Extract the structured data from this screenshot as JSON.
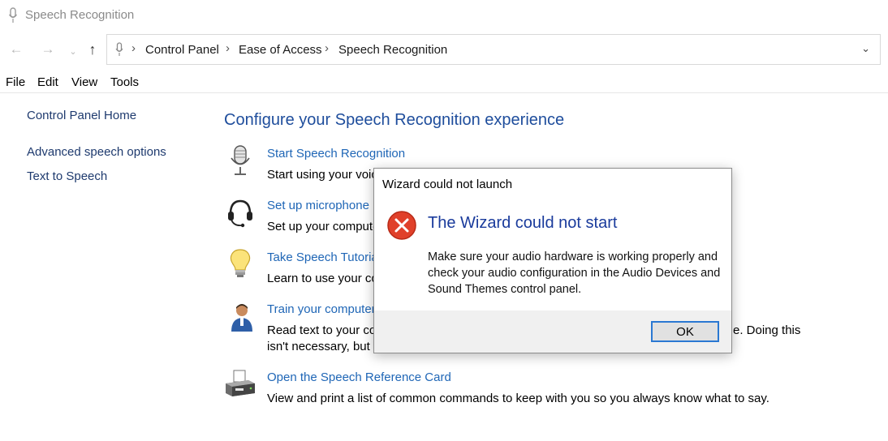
{
  "window": {
    "title": "Speech Recognition"
  },
  "address_bar": {
    "crumbs": [
      "Control Panel",
      "Ease of Access",
      "Speech Recognition"
    ]
  },
  "menu": {
    "items": [
      "File",
      "Edit",
      "View",
      "Tools"
    ]
  },
  "sidebar": {
    "items": [
      "Control Panel Home",
      "Advanced speech options",
      "Text to Speech"
    ]
  },
  "main": {
    "heading": "Configure your Speech Recognition experience",
    "tasks": [
      {
        "link": "Start Speech Recognition",
        "desc": "Start using your voic",
        "icon": "microphone-icon"
      },
      {
        "link": "Set up microphone",
        "desc": "Set up your compute",
        "icon": "headset-icon"
      },
      {
        "link": "Take Speech Tutoria",
        "desc": "Learn to use your co",
        "icon": "lightbulb-icon"
      },
      {
        "link": "Train your computer",
        "desc": "Read text to your co",
        "desc_tail": "e.  Doing this",
        "desc2": "isn't necessary, but c",
        "icon": "user-icon"
      },
      {
        "link": "Open the Speech Reference Card",
        "desc": "View and print a list of common commands to keep with you so you always know what to say.",
        "icon": "printer-icon"
      }
    ]
  },
  "dialog": {
    "title": "Wizard could not launch",
    "heading": "The Wizard could not start",
    "message": "Make sure your audio hardware is working properly and check your audio configuration in the Audio Devices and Sound Themes control panel.",
    "ok_label": "OK",
    "icon": "error-icon"
  },
  "colors": {
    "link": "#1f66b6",
    "heading": "#1e4d9c",
    "error": "#e0402a",
    "focus": "#2a78d2"
  }
}
